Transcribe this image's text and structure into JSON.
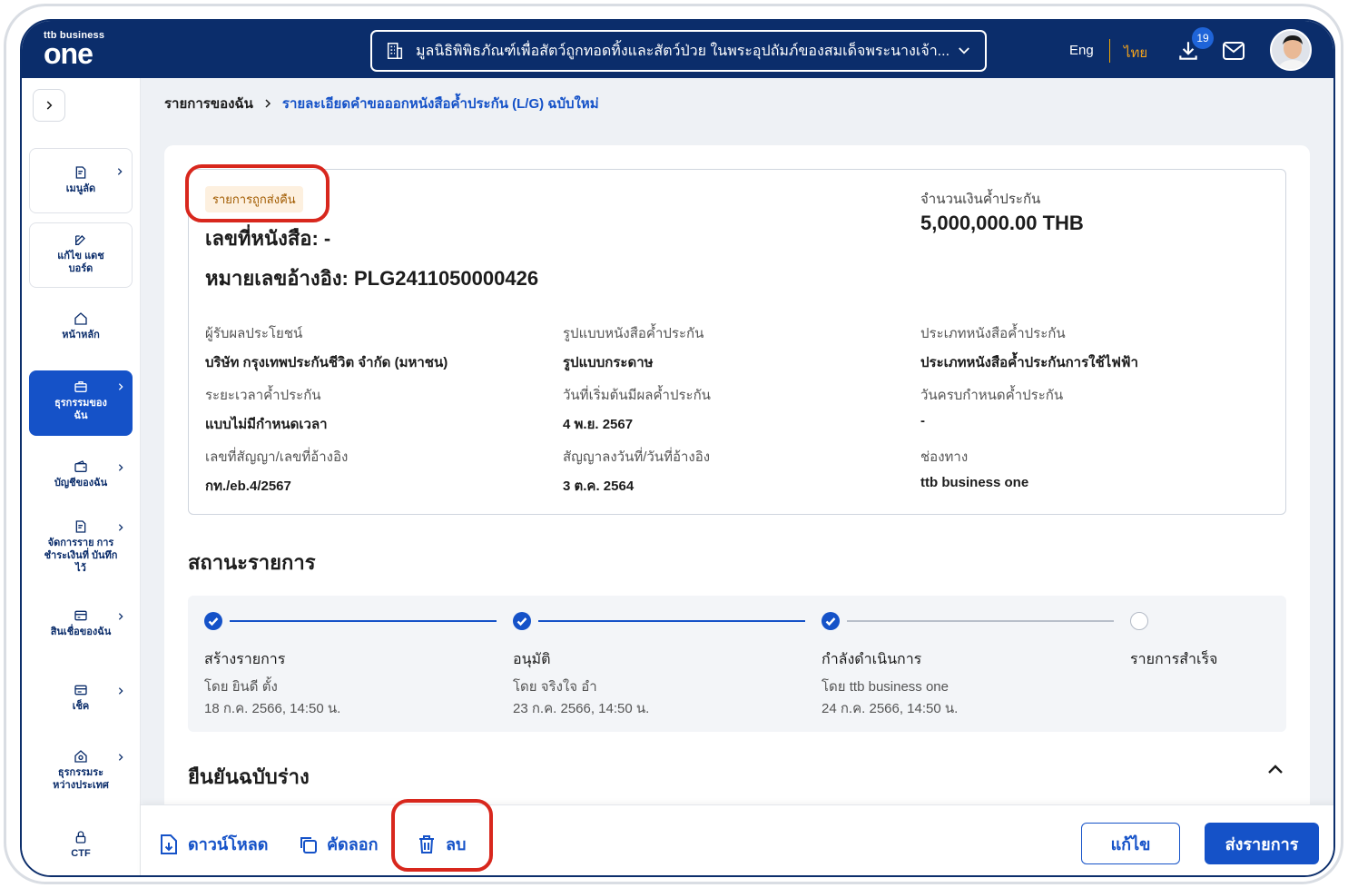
{
  "header": {
    "logo_small": "ttb business",
    "logo_big": "one",
    "org_name": "มูลนิธิพิพิธภัณฑ์เพื่อสัตว์ถูกทอดทิ้งและสัตว์ป่วย ในพระอุปถัมภ์ของสมเด็จพระนางเจ้า...",
    "lang_en": "Eng",
    "lang_th": "ไทย",
    "download_count": "19"
  },
  "sidebar": {
    "items": [
      {
        "label": "เมนูลัด"
      },
      {
        "label": "แก้ไข แดชบอร์ด"
      },
      {
        "label": "หน้าหลัก"
      },
      {
        "label": "ธุรกรรมของ ฉัน"
      },
      {
        "label": "บัญชีของฉัน"
      },
      {
        "label": "จัดการราย การชำระเงินที่ บันทึกไว้"
      },
      {
        "label": "สินเชื่อของฉัน"
      },
      {
        "label": "เช็ค"
      },
      {
        "label": "ธุรกรรมระ หว่างประเทศ"
      },
      {
        "label": "CTF"
      }
    ]
  },
  "breadcrumb": {
    "root": "รายการของฉัน",
    "current": "รายละเอียดคำขอออกหนังสือค้ำประกัน (L/G) ฉบับใหม่"
  },
  "card": {
    "tag": "รายการถูกส่งคืน",
    "doc_no": "เลขที่หนังสือ: -",
    "ref_no": "หมายเลขอ้างอิง: PLG2411050000426",
    "amount_label": "จำนวนเงินค้ำประกัน",
    "amount_value": "5,000,000.00 THB",
    "fields": [
      {
        "label": "ผู้รับผลประโยชน์",
        "value": "บริษัท กรุงเทพประกันชีวิต จำกัด (มหาชน)"
      },
      {
        "label": "รูปแบบหนังสือค้ำประกัน",
        "value": "รูปแบบกระดาษ"
      },
      {
        "label": "ประเภทหนังสือค้ำประกัน",
        "value": "ประเภทหนังสือค้ำประกันการใช้ไฟฟ้า"
      },
      {
        "label": "ระยะเวลาค้ำประกัน",
        "value": "แบบไม่มีกำหนดเวลา"
      },
      {
        "label": "วันที่เริ่มต้นมีผลค้ำประกัน",
        "value": "4 พ.ย. 2567"
      },
      {
        "label": "วันครบกำหนดค้ำประกัน",
        "value": "-"
      },
      {
        "label": "เลขที่สัญญา/เลขที่อ้างอิง",
        "value": "กท./eb.4/2567"
      },
      {
        "label": "สัญญาลงวันที่/วันที่อ้างอิง",
        "value": "3 ต.ค. 2564"
      },
      {
        "label": "ช่องทาง",
        "value": "ttb business one"
      }
    ]
  },
  "status": {
    "title": "สถานะรายการ",
    "steps": [
      {
        "name": "สร้างรายการ",
        "by": "โดย ยินดี ตั้ง",
        "date": "18 ก.ค. 2566, 14:50 น.",
        "done": true
      },
      {
        "name": "อนุมัติ",
        "by": "โดย จริงใจ อำ",
        "date": "23 ก.ค. 2566, 14:50 น.",
        "done": true
      },
      {
        "name": "กำลังดำเนินการ",
        "by": "โดย ttb business one",
        "date": "24 ก.ค. 2566, 14:50 น.",
        "done": true
      },
      {
        "name": "รายการสำเร็จ",
        "by": "",
        "date": "",
        "done": false
      }
    ]
  },
  "draft_section": {
    "title": "ยืนยันฉบับร่าง"
  },
  "footer": {
    "download": "ดาวน์โหลด",
    "copy": "คัดลอก",
    "delete": "ลบ",
    "edit": "แก้ไข",
    "submit": "ส่งรายการ"
  },
  "colors": {
    "navy": "#0b2d6b",
    "primary": "#1552c8",
    "annotation_red": "#d8271d",
    "tag_bg": "#fdf0df"
  }
}
